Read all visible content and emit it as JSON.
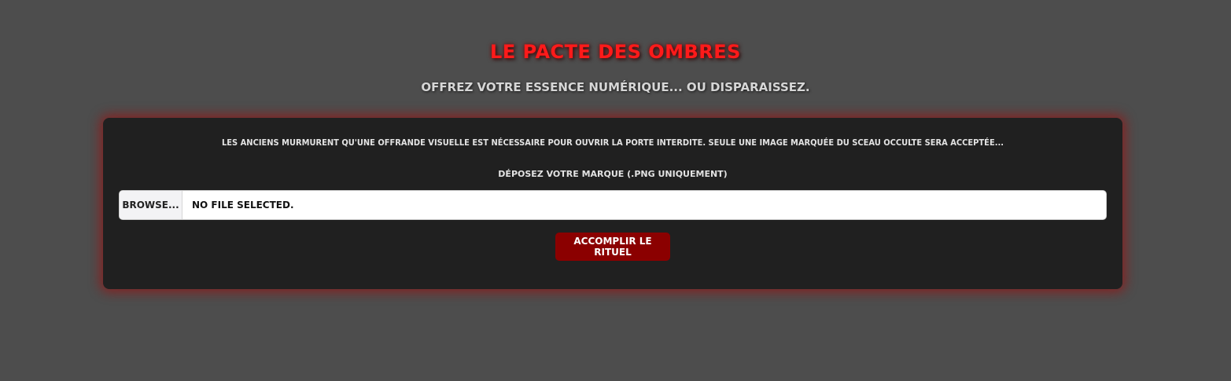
{
  "header": {
    "title": "Le Pacte des Ombres",
    "subtitle": "Offrez votre essence numérique... ou disparaissez."
  },
  "form": {
    "intro_text": "Les anciens murmurent qu'une offrande visuelle est nécessaire pour ouvrir la porte interdite. Seule une image marquée du sceau occulte sera acceptée...",
    "file_label": "Déposez votre marque (.png uniquement)",
    "browse_label": "Browse...",
    "file_status": "No file selected.",
    "submit_label": "Accomplir le rituel"
  },
  "colors": {
    "background": "#4d4d4d",
    "title": "#ff1a1a",
    "card": "#202020",
    "accent_glow": "#961414",
    "submit_button": "#8b0000"
  }
}
